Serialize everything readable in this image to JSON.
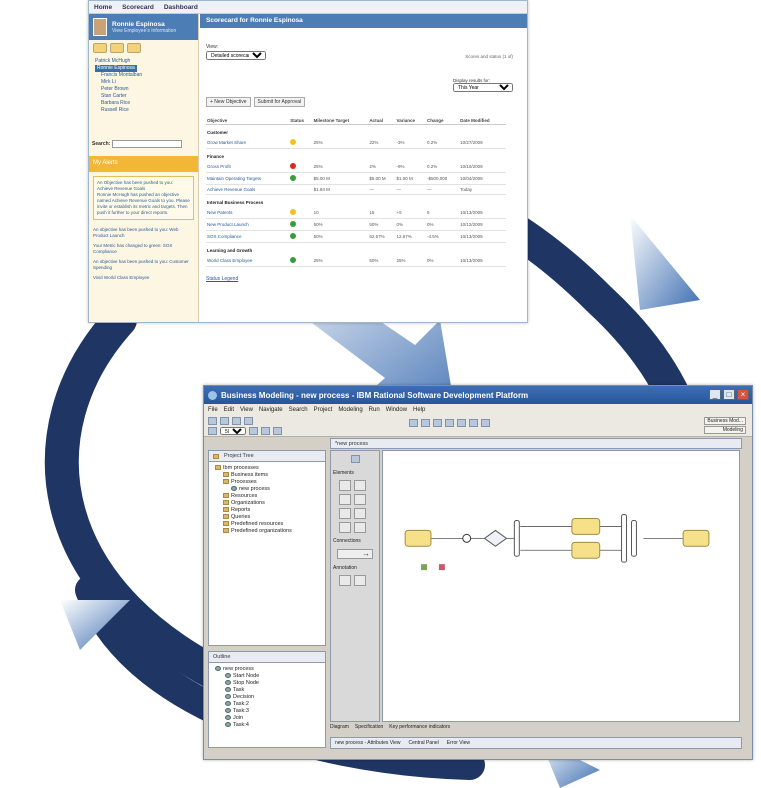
{
  "colors": {
    "swoosh": "#1f3563",
    "accent_blue": "#4d7db5",
    "alert_orange": "#f2b737",
    "task_yellow": "#f6e08a"
  },
  "scorecard": {
    "topnav": [
      "Home",
      "Scorecard",
      "Dashboard"
    ],
    "user_name": "Ronnie Espinosa",
    "user_sub": "View Employee's Information",
    "tree": [
      "Patrick McHugh",
      "Ronnie Espinosa",
      "Francis Montalban",
      "Mirk Li",
      "Peter Brown",
      "Stan Carter",
      "Barbara Rice",
      "Russell Rice"
    ],
    "search_label": "Search:",
    "alerts_title": "My Alerts",
    "alerts": [
      "An Objective has been pushed to you: Achieve Revenue Goals",
      "Ronnie McHugh has pushed an objective named Achieve Revenue Goals to you. Please invite or establish its metric and targets. Then push it further to your direct reports.",
      "An objective has been pushed to you: Web Product Launch",
      "Your Metric has changed to green: SOX Compliance",
      "An objective has been pushed to you: Customer Spending",
      "Vivid World Class Employee"
    ],
    "title": "Scorecard for Ronnie Espinosa",
    "view_label": "View:",
    "view_value": "Detailed scorecard",
    "scores_label": "Scores and status (1 of)",
    "display_label": "Display results for:",
    "display_value": "This Year",
    "buttons": [
      "+ New Objective",
      "Submit for Approval"
    ],
    "columns": [
      "Objective",
      "Status",
      "Milestone Target",
      "Actual",
      "Variance",
      "Change",
      "Date Modified"
    ],
    "rows": [
      {
        "category": "Customer"
      },
      {
        "objective": "Grow Market Share",
        "status": "#f4c021",
        "target": "25%",
        "actual": "22%",
        "variance": "-3%",
        "change": "0.2%",
        "date": "10/27/2009"
      },
      {
        "category": "Finance"
      },
      {
        "objective": "Gross Profit",
        "status": "#d9291c",
        "target": "25%",
        "actual": "2%",
        "variance": "-9%",
        "change": "0.2%",
        "date": "10/10/2009"
      },
      {
        "objective": "Maintain Operating Targets",
        "status": "#3a9d3a",
        "target": "$5.00 M",
        "actual": "$6.00 M",
        "variance": "$1.00 M",
        "change": "-$500,000",
        "date": "10/04/2009"
      },
      {
        "objective": "Achieve Revenue Goals",
        "status": "",
        "target": "$1.93 M",
        "actual": "—",
        "variance": "—",
        "change": "—",
        "date": "Today"
      },
      {
        "category": "Internal Business Process"
      },
      {
        "objective": "New Patents",
        "status": "#f4c021",
        "target": "10",
        "actual": "15",
        "variance": "+5",
        "change": "5",
        "date": "10/13/2009"
      },
      {
        "objective": "New Product Launch",
        "status": "#3a9d3a",
        "target": "50%",
        "actual": "50%",
        "variance": "0%",
        "change": "0%",
        "date": "10/12/2009"
      },
      {
        "objective": "SOX Compliance",
        "status": "#3a9d3a",
        "target": "50%",
        "actual": "62.67%",
        "variance": "12.67%",
        "change": "-4.5%",
        "date": "10/13/2009"
      },
      {
        "category": "Learning and Growth"
      },
      {
        "objective": "World Class Employee",
        "status": "#3a9d3a",
        "target": "25%",
        "actual": "50%",
        "variance": "25%",
        "change": "0%",
        "date": "10/13/2009"
      }
    ],
    "history_link": "Status Legend"
  },
  "eclipse": {
    "title": "Business Modeling - new process - IBM Rational Software Development Platform",
    "menu": [
      "File",
      "Edit",
      "View",
      "Navigate",
      "Search",
      "Project",
      "Modeling",
      "Run",
      "Window",
      "Help"
    ],
    "zoom": "50%",
    "perspectives": [
      "Business Mod...",
      "Modeling"
    ],
    "project_tree_tab": "Project Tree",
    "project_tree": [
      "Ibm processes",
      "Business items",
      "Processes",
      "new process",
      "Resources",
      "Organizations",
      "Reports",
      "Queries",
      "Predefined resources",
      "Predefined organizations"
    ],
    "editor_tab": "*new process",
    "palette_elements": "Elements",
    "palette_connections": "Connections",
    "palette_annotation": "Annotation",
    "outline_tab": "Outline",
    "outline": [
      "new process",
      "Start Node",
      "Stop Node",
      "Task",
      "Decision",
      "Task:2",
      "Task:3",
      "Join",
      "Task:4"
    ],
    "editor_tabs": [
      "Diagram",
      "Specification",
      "Key performance indicators"
    ],
    "bottom_views": [
      "new process - Attributes View",
      "Central Panel",
      "Error View"
    ]
  }
}
